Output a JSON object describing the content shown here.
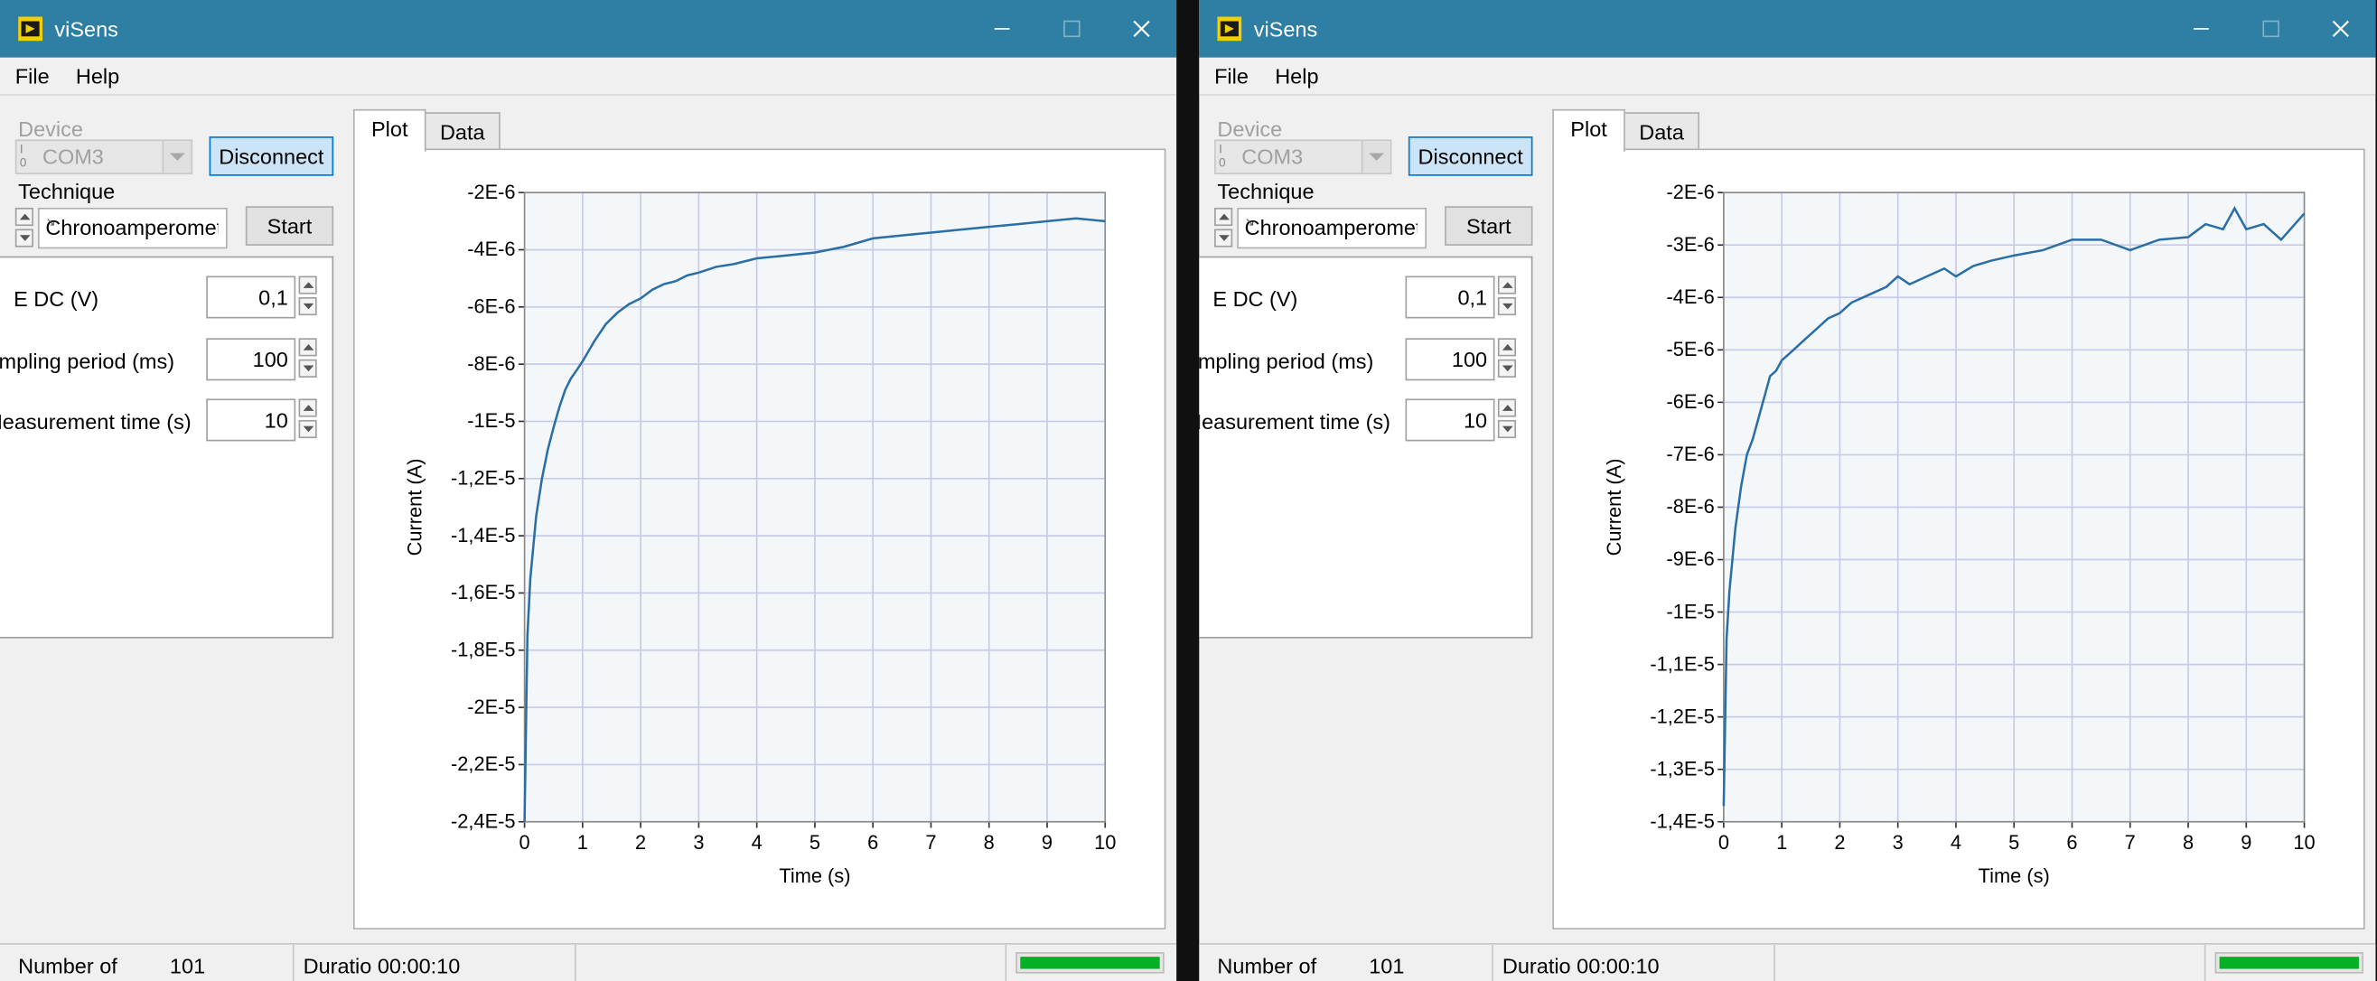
{
  "colors": {
    "titlebar": "#2e7fa3",
    "plot_line": "#2a6ea6",
    "progress": "#06b025",
    "grid": "#c9c9ea",
    "plot_bg": "#f3f7f9"
  },
  "windows": [
    {
      "title": "viSens",
      "menu": [
        "File",
        "Help"
      ],
      "device": {
        "label": "Device",
        "value": "COM3",
        "disconnect_label": "Disconnect"
      },
      "technique": {
        "label": "Technique",
        "value": "Chronoamperometry",
        "start_label": "Start"
      },
      "params": [
        {
          "label": "E DC (V)",
          "value": "0,1"
        },
        {
          "label": "Sampling period (ms)",
          "value": "100"
        },
        {
          "label": "Measurement time (s)",
          "value": "10"
        }
      ],
      "tabs": [
        "Plot",
        "Data"
      ],
      "status": {
        "number_label": "Number of",
        "number_value": "101",
        "duration_text": "Duratio 00:00:10",
        "progress": 1.0
      }
    },
    {
      "title": "viSens",
      "menu": [
        "File",
        "Help"
      ],
      "device": {
        "label": "Device",
        "value": "COM3",
        "disconnect_label": "Disconnect"
      },
      "technique": {
        "label": "Technique",
        "value": "Chronoamperometry",
        "start_label": "Start"
      },
      "params": [
        {
          "label": "E DC (V)",
          "value": "0,1"
        },
        {
          "label": "Sampling period (ms)",
          "value": "100"
        },
        {
          "label": "Measurement time (s)",
          "value": "10"
        }
      ],
      "tabs": [
        "Plot",
        "Data"
      ],
      "status": {
        "number_label": "Number of",
        "number_value": "101",
        "duration_text": "Duratio 00:00:10",
        "progress": 1.0
      }
    }
  ],
  "chart_data": [
    {
      "type": "line",
      "xlabel": "Time (s)",
      "ylabel": "Current (A)",
      "xlim": [
        0,
        10
      ],
      "ylim": [
        -2.4e-05,
        -2e-06
      ],
      "x_ticks": [
        "0",
        "1",
        "2",
        "3",
        "4",
        "5",
        "6",
        "7",
        "8",
        "9",
        "10"
      ],
      "y_ticks": [
        "-2E-6",
        "-4E-6",
        "-6E-6",
        "-8E-6",
        "-1E-5",
        "-1,2E-5",
        "-1,4E-5",
        "-1,6E-5",
        "-1,8E-5",
        "-2E-5",
        "-2,2E-5",
        "-2,4E-5"
      ],
      "grid": true,
      "series": [
        {
          "x": [
            0,
            0.05,
            0.1,
            0.2,
            0.3,
            0.4,
            0.5,
            0.6,
            0.7,
            0.8,
            0.9,
            1.0,
            1.2,
            1.4,
            1.6,
            1.8,
            2.0,
            2.2,
            2.4,
            2.6,
            2.8,
            3.0,
            3.3,
            3.6,
            4.0,
            4.5,
            5.0,
            5.5,
            6.0,
            6.5,
            7.0,
            7.5,
            8.0,
            8.5,
            9.0,
            9.5,
            10.0
          ],
          "y": [
            -2.4e-05,
            -1.75e-05,
            -1.55e-05,
            -1.33e-05,
            -1.2e-05,
            -1.1e-05,
            -1.02e-05,
            -9.5e-06,
            -8.9e-06,
            -8.5e-06,
            -8.2e-06,
            -7.9e-06,
            -7.2e-06,
            -6.6e-06,
            -6.2e-06,
            -5.9e-06,
            -5.7e-06,
            -5.4e-06,
            -5.2e-06,
            -5.1e-06,
            -4.9e-06,
            -4.8e-06,
            -4.6e-06,
            -4.5e-06,
            -4.3e-06,
            -4.2e-06,
            -4.1e-06,
            -3.9e-06,
            -3.6e-06,
            -3.5e-06,
            -3.4e-06,
            -3.3e-06,
            -3.2e-06,
            -3.1e-06,
            -3e-06,
            -2.9e-06,
            -3e-06
          ]
        }
      ]
    },
    {
      "type": "line",
      "xlabel": "Time (s)",
      "ylabel": "Current (A)",
      "xlim": [
        0,
        10
      ],
      "ylim": [
        -1.4e-05,
        -2e-06
      ],
      "x_ticks": [
        "0",
        "1",
        "2",
        "3",
        "4",
        "5",
        "6",
        "7",
        "8",
        "9",
        "10"
      ],
      "y_ticks": [
        "-2E-6",
        "-3E-6",
        "-4E-6",
        "-5E-6",
        "-6E-6",
        "-7E-6",
        "-8E-6",
        "-9E-6",
        "-1E-5",
        "-1,1E-5",
        "-1,2E-5",
        "-1,3E-5",
        "-1,4E-5"
      ],
      "grid": true,
      "series": [
        {
          "x": [
            0,
            0.05,
            0.1,
            0.2,
            0.3,
            0.4,
            0.5,
            0.6,
            0.7,
            0.8,
            0.9,
            1.0,
            1.2,
            1.4,
            1.6,
            1.8,
            2.0,
            2.2,
            2.4,
            2.6,
            2.8,
            3.0,
            3.2,
            3.5,
            3.8,
            4.0,
            4.3,
            4.6,
            5.0,
            5.5,
            6.0,
            6.5,
            7.0,
            7.5,
            8.0,
            8.3,
            8.6,
            8.8,
            9.0,
            9.3,
            9.6,
            10.0
          ],
          "y": [
            -1.37e-05,
            -1.05e-05,
            -9.6e-06,
            -8.4e-06,
            -7.6e-06,
            -7e-06,
            -6.7e-06,
            -6.3e-06,
            -5.9e-06,
            -5.5e-06,
            -5.4e-06,
            -5.2e-06,
            -5e-06,
            -4.8e-06,
            -4.6e-06,
            -4.4e-06,
            -4.3e-06,
            -4.1e-06,
            -4e-06,
            -3.9e-06,
            -3.8e-06,
            -3.6e-06,
            -3.75e-06,
            -3.6e-06,
            -3.45e-06,
            -3.6e-06,
            -3.4e-06,
            -3.3e-06,
            -3.2e-06,
            -3.1e-06,
            -2.9e-06,
            -2.9e-06,
            -3.1e-06,
            -2.9e-06,
            -2.85e-06,
            -2.6e-06,
            -2.7e-06,
            -2.3e-06,
            -2.7e-06,
            -2.6e-06,
            -2.9e-06,
            -2.4e-06
          ]
        }
      ]
    }
  ]
}
